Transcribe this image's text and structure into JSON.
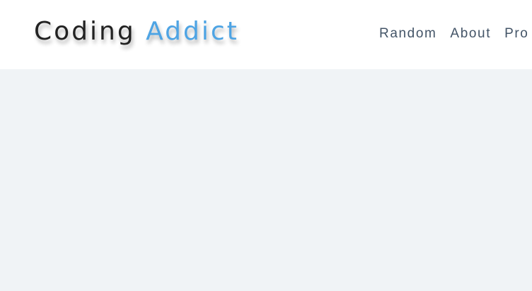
{
  "header": {
    "logo": {
      "first": "Coding",
      "second": "Addict"
    },
    "nav": [
      {
        "label": "Random"
      },
      {
        "label": "About"
      },
      {
        "label": "Pro"
      }
    ]
  },
  "colors": {
    "logo_primary": "#222222",
    "logo_accent": "#4ea4e4",
    "nav_text": "#435467",
    "header_bg": "#ffffff",
    "page_bg": "#f0f3f6"
  }
}
